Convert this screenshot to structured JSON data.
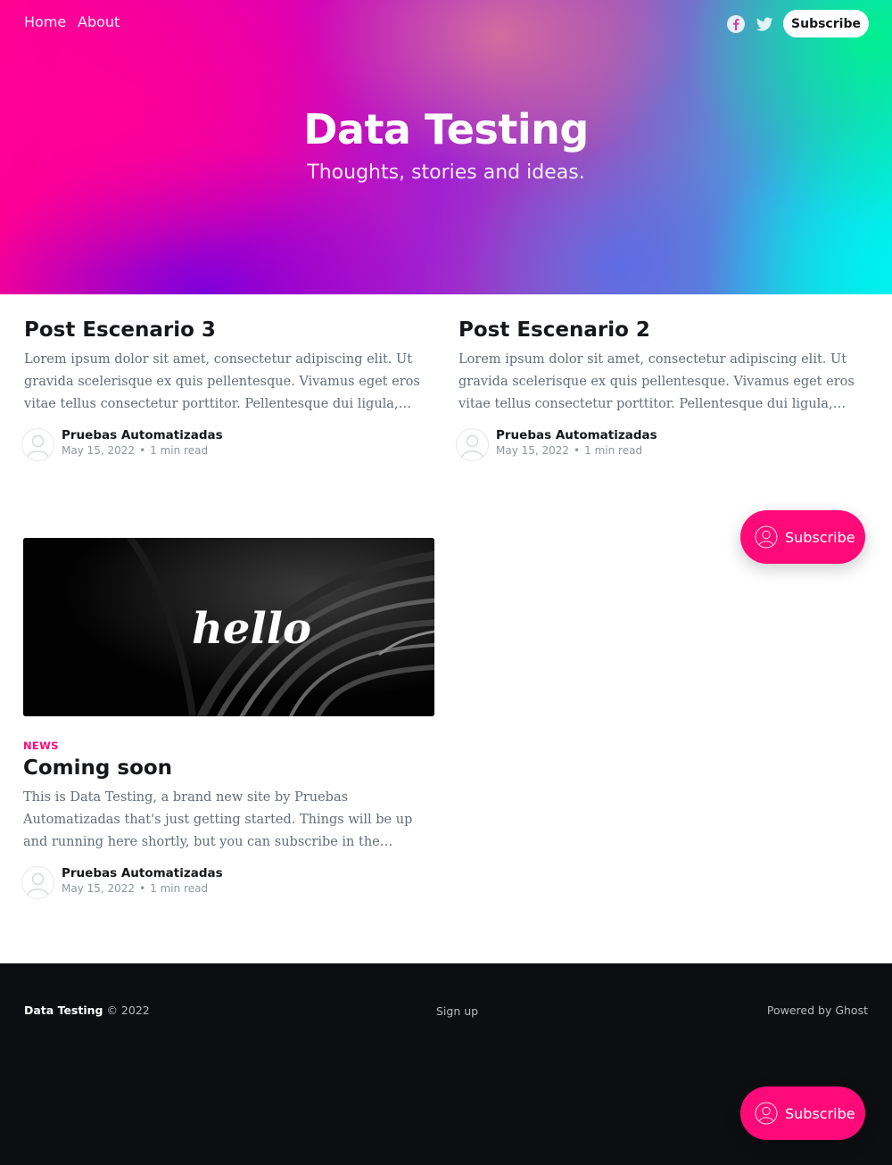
{
  "nav": {
    "items": [
      {
        "label": "Home"
      },
      {
        "label": "About"
      }
    ],
    "subscribe_label": "Subscribe"
  },
  "icons": {
    "facebook": "facebook-icon",
    "twitter": "twitter-icon",
    "member": "member-icon",
    "avatar": "user-avatar-icon"
  },
  "site": {
    "title": "Data Testing",
    "description": "Thoughts, stories and ideas."
  },
  "posts": [
    {
      "title": "Post Escenario 3",
      "excerpt": "Lorem ipsum dolor sit amet, consectetur adipiscing elit. Ut gravida scelerisque ex quis pellentesque. Vivamus eget eros vitae tellus consectetur porttitor. Pellentesque dui ligula, consequat quis feugiat…",
      "author": "Pruebas Automatizadas",
      "date": "May 15, 2022",
      "separator": "•",
      "reading_time": "1 min read"
    },
    {
      "title": "Post Escenario 2",
      "excerpt": "Lorem ipsum dolor sit amet, consectetur adipiscing elit. Ut gravida scelerisque ex quis pellentesque. Vivamus eget eros vitae tellus consectetur porttitor. Pellentesque dui ligula, consequat quis feugiat…",
      "author": "Pruebas Automatizadas",
      "date": "May 15, 2022",
      "separator": "•",
      "reading_time": "1 min read"
    },
    {
      "image_text": "hello",
      "tag": "NEWS",
      "title": "Coming soon",
      "excerpt": "This is Data Testing, a brand new site by Pruebas Automatizadas that's just getting started. Things will be up and running here shortly, but you can subscribe in the meantime if you'd like to stay up to date and…",
      "author": "Pruebas Automatizadas",
      "date": "May 15, 2022",
      "separator": "•",
      "reading_time": "1 min read"
    }
  ],
  "floating_subscribe": {
    "label": "Subscribe"
  },
  "footer": {
    "site_name": "Data Testing",
    "copyright": "© 2022",
    "signup": "Sign up",
    "powered": "Powered by Ghost"
  },
  "colors": {
    "accent": "#ff0a78",
    "footer_bg": "#0d0e11",
    "text": "#15171a",
    "muted": "#626d79"
  }
}
